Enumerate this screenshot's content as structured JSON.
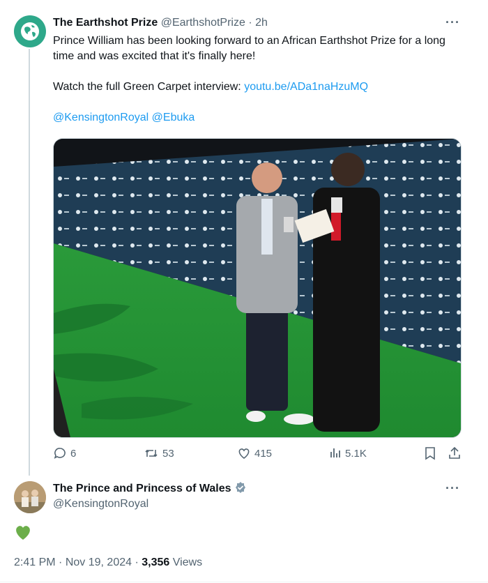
{
  "tweet1": {
    "author_name": "The Earthshot Prize",
    "handle": "@EarthshotPrize",
    "separator": "·",
    "time": "2h",
    "more_label": "···",
    "line1": "Prince William has been looking forward to an African Earthshot Prize for a long time and was excited that it's finally here!",
    "line2_prefix": "Watch the full Green Carpet interview: ",
    "line2_link": "youtu.be/ADa1naHzuMQ",
    "mention1": "@KensingtonRoyal",
    "mention2": "@Ebuka",
    "actions": {
      "replies": "6",
      "reposts": "53",
      "likes": "415",
      "views": "5.1K"
    }
  },
  "tweet2": {
    "author_name": "The Prince and Princess of Wales",
    "handle": "@KensingtonRoyal",
    "more_label": "···",
    "time": "2:41 PM",
    "dot": "·",
    "date": "Nov 19, 2024",
    "dot2": "·",
    "views_count": "3,356",
    "views_label": "Views"
  },
  "colors": {
    "link": "#1d9bf0",
    "verified": "#829aab",
    "heart": "#6cae4a",
    "carpet": "#2f9e3c",
    "backdrop": "#1f3d55"
  }
}
